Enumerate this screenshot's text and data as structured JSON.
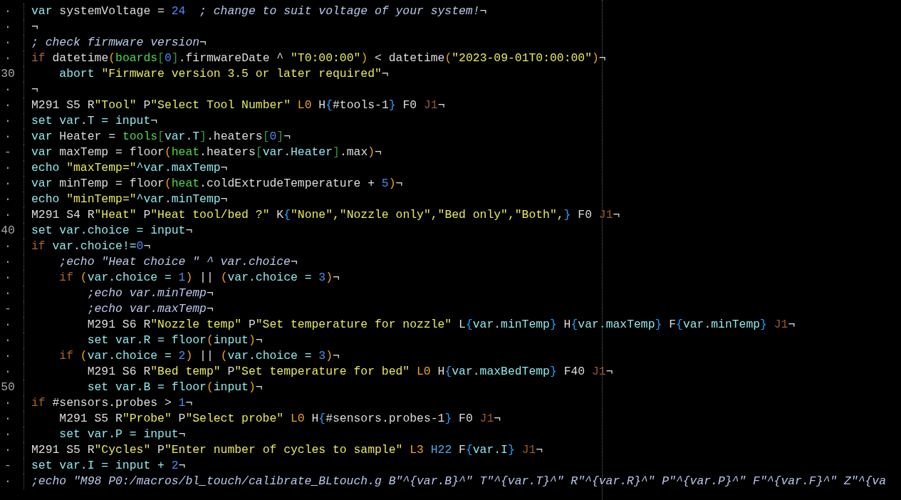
{
  "editor": {
    "lines": [
      {
        "gutter": "·",
        "tokens": [
          {
            "kind": "kw",
            "text": "var"
          },
          {
            "kind": "id",
            "text": " systemVoltage = "
          },
          {
            "kind": "num",
            "text": "24"
          },
          {
            "kind": "com",
            "text": "  ; change to suit voltage of your system!"
          },
          {
            "kind": "eol",
            "text": "¬"
          }
        ]
      },
      {
        "gutter": "·",
        "tokens": [
          {
            "kind": "eol",
            "text": "¬"
          }
        ]
      },
      {
        "gutter": "·",
        "tokens": [
          {
            "kind": "com",
            "text": "; check firmware version"
          },
          {
            "kind": "eol",
            "text": "¬"
          }
        ]
      },
      {
        "gutter": "·",
        "tokens": [
          {
            "kind": "ctl",
            "text": "if"
          },
          {
            "kind": "id",
            "text": " datetime"
          },
          {
            "kind": "paren",
            "text": "("
          },
          {
            "kind": "obj",
            "text": "boards"
          },
          {
            "kind": "brk",
            "text": "["
          },
          {
            "kind": "num",
            "text": "0"
          },
          {
            "kind": "brk",
            "text": "]"
          },
          {
            "kind": "id",
            "text": ".firmwareDate ^ "
          },
          {
            "kind": "str",
            "text": "\"T0:00:00\""
          },
          {
            "kind": "paren",
            "text": ")"
          },
          {
            "kind": "id",
            "text": " < datetime"
          },
          {
            "kind": "paren",
            "text": "("
          },
          {
            "kind": "str",
            "text": "\"2023-09-01T0:00:00\""
          },
          {
            "kind": "paren",
            "text": ")"
          },
          {
            "kind": "eol",
            "text": "¬"
          }
        ]
      },
      {
        "gutter": "30",
        "tokens": [
          {
            "kind": "kw",
            "text": "    abort "
          },
          {
            "kind": "str",
            "text": "\"Firmware version 3.5 or later required\""
          },
          {
            "kind": "eol",
            "text": "¬"
          }
        ]
      },
      {
        "gutter": "·",
        "tokens": [
          {
            "kind": "eol",
            "text": "¬"
          }
        ]
      },
      {
        "gutter": "·",
        "tokens": [
          {
            "kind": "id",
            "text": "M291 S5 R"
          },
          {
            "kind": "str",
            "text": "\"Tool\""
          },
          {
            "kind": "id",
            "text": " P"
          },
          {
            "kind": "str",
            "text": "\"Select Tool Number\""
          },
          {
            "kind": "lp",
            "text": " L0"
          },
          {
            "kind": "id",
            "text": " H"
          },
          {
            "kind": "brace",
            "text": "{"
          },
          {
            "kind": "id",
            "text": "#tools-1"
          },
          {
            "kind": "brace",
            "text": "}"
          },
          {
            "kind": "id",
            "text": " F0 "
          },
          {
            "kind": "jp",
            "text": "J1"
          },
          {
            "kind": "eol",
            "text": "¬"
          }
        ]
      },
      {
        "gutter": "·",
        "tokens": [
          {
            "kind": "kw",
            "text": "set var.T = input"
          },
          {
            "kind": "eol",
            "text": "¬"
          }
        ]
      },
      {
        "gutter": "·",
        "tokens": [
          {
            "kind": "kw",
            "text": "var"
          },
          {
            "kind": "id",
            "text": " Heater = "
          },
          {
            "kind": "obj",
            "text": "tools"
          },
          {
            "kind": "brk",
            "text": "["
          },
          {
            "kind": "kw",
            "text": "var.T"
          },
          {
            "kind": "brk",
            "text": "]"
          },
          {
            "kind": "id",
            "text": ".heaters"
          },
          {
            "kind": "brk",
            "text": "["
          },
          {
            "kind": "num",
            "text": "0"
          },
          {
            "kind": "brk",
            "text": "]"
          },
          {
            "kind": "eol",
            "text": "¬"
          }
        ]
      },
      {
        "gutter": "-",
        "tokens": [
          {
            "kind": "kw",
            "text": "var"
          },
          {
            "kind": "id",
            "text": " maxTemp = floor"
          },
          {
            "kind": "paren",
            "text": "("
          },
          {
            "kind": "obj",
            "text": "heat"
          },
          {
            "kind": "id",
            "text": ".heaters"
          },
          {
            "kind": "brk",
            "text": "["
          },
          {
            "kind": "kw",
            "text": "var.Heater"
          },
          {
            "kind": "brk",
            "text": "]"
          },
          {
            "kind": "id",
            "text": ".max"
          },
          {
            "kind": "paren",
            "text": ")"
          },
          {
            "kind": "eol",
            "text": "¬"
          }
        ]
      },
      {
        "gutter": "·",
        "tokens": [
          {
            "kind": "kw",
            "text": "echo "
          },
          {
            "kind": "str",
            "text": "\"maxTemp=\""
          },
          {
            "kind": "kw",
            "text": "^var.maxTemp"
          },
          {
            "kind": "eol",
            "text": "¬"
          }
        ]
      },
      {
        "gutter": "·",
        "tokens": [
          {
            "kind": "kw",
            "text": "var"
          },
          {
            "kind": "id",
            "text": " minTemp = floor"
          },
          {
            "kind": "paren",
            "text": "("
          },
          {
            "kind": "obj",
            "text": "heat"
          },
          {
            "kind": "id",
            "text": ".coldExtrudeTemperature + "
          },
          {
            "kind": "num",
            "text": "5"
          },
          {
            "kind": "paren",
            "text": ")"
          },
          {
            "kind": "eol",
            "text": "¬"
          }
        ]
      },
      {
        "gutter": "·",
        "tokens": [
          {
            "kind": "kw",
            "text": "echo "
          },
          {
            "kind": "str",
            "text": "\"minTemp=\""
          },
          {
            "kind": "kw",
            "text": "^var.minTemp"
          },
          {
            "kind": "eol",
            "text": "¬"
          }
        ]
      },
      {
        "gutter": "·",
        "tokens": [
          {
            "kind": "id",
            "text": "M291 S4 R"
          },
          {
            "kind": "str",
            "text": "\"Heat\""
          },
          {
            "kind": "id",
            "text": " P"
          },
          {
            "kind": "str",
            "text": "\"Heat tool/bed ?\""
          },
          {
            "kind": "id",
            "text": " K"
          },
          {
            "kind": "brace",
            "text": "{"
          },
          {
            "kind": "str",
            "text": "\"None\",\"Nozzle only\",\"Bed only\",\"Both\","
          },
          {
            "kind": "brace",
            "text": "}"
          },
          {
            "kind": "id",
            "text": " F0 "
          },
          {
            "kind": "jp",
            "text": "J1"
          },
          {
            "kind": "eol",
            "text": "¬"
          }
        ]
      },
      {
        "gutter": "40",
        "tokens": [
          {
            "kind": "kw",
            "text": "set var.choice = input"
          },
          {
            "kind": "eol",
            "text": "¬"
          }
        ]
      },
      {
        "gutter": "·",
        "tokens": [
          {
            "kind": "ctl",
            "text": "if"
          },
          {
            "kind": "kw",
            "text": " var.choice!="
          },
          {
            "kind": "num",
            "text": "0"
          },
          {
            "kind": "eol",
            "text": "¬"
          }
        ]
      },
      {
        "gutter": "·",
        "tokens": [
          {
            "kind": "com",
            "text": "    ;echo \"Heat choice \" ^ var.choice"
          },
          {
            "kind": "eol",
            "text": "¬"
          }
        ]
      },
      {
        "gutter": "·",
        "tokens": [
          {
            "kind": "ctl",
            "text": "    if "
          },
          {
            "kind": "paren",
            "text": "("
          },
          {
            "kind": "kw",
            "text": "var.choice = "
          },
          {
            "kind": "num",
            "text": "1"
          },
          {
            "kind": "paren",
            "text": ")"
          },
          {
            "kind": "id",
            "text": " || "
          },
          {
            "kind": "paren",
            "text": "("
          },
          {
            "kind": "kw",
            "text": "var.choice = "
          },
          {
            "kind": "num",
            "text": "3"
          },
          {
            "kind": "paren",
            "text": ")"
          },
          {
            "kind": "eol",
            "text": "¬"
          }
        ]
      },
      {
        "gutter": "·",
        "tokens": [
          {
            "kind": "com",
            "text": "        ;echo var.minTemp"
          },
          {
            "kind": "eol",
            "text": "¬"
          }
        ]
      },
      {
        "gutter": "-",
        "tokens": [
          {
            "kind": "com",
            "text": "        ;echo var.maxTemp"
          },
          {
            "kind": "eol",
            "text": "¬"
          }
        ]
      },
      {
        "gutter": "·",
        "tokens": [
          {
            "kind": "id",
            "text": "        M291 S6 R"
          },
          {
            "kind": "str",
            "text": "\"Nozzle temp\""
          },
          {
            "kind": "id",
            "text": " P"
          },
          {
            "kind": "str",
            "text": "\"Set temperature for nozzle\""
          },
          {
            "kind": "id",
            "text": " L"
          },
          {
            "kind": "brace",
            "text": "{"
          },
          {
            "kind": "kw",
            "text": "var.minTemp"
          },
          {
            "kind": "brace",
            "text": "}"
          },
          {
            "kind": "id",
            "text": " H"
          },
          {
            "kind": "brace",
            "text": "{"
          },
          {
            "kind": "kw",
            "text": "var.maxTemp"
          },
          {
            "kind": "brace",
            "text": "}"
          },
          {
            "kind": "id",
            "text": " F"
          },
          {
            "kind": "brace",
            "text": "{"
          },
          {
            "kind": "kw",
            "text": "var.minTemp"
          },
          {
            "kind": "brace",
            "text": "}"
          },
          {
            "kind": "jp",
            "text": " J1"
          },
          {
            "kind": "eol",
            "text": "¬"
          }
        ]
      },
      {
        "gutter": "·",
        "tokens": [
          {
            "kind": "kw",
            "text": "        set var.R = floor"
          },
          {
            "kind": "paren",
            "text": "("
          },
          {
            "kind": "kw",
            "text": "input"
          },
          {
            "kind": "paren",
            "text": ")"
          },
          {
            "kind": "eol",
            "text": "¬"
          }
        ]
      },
      {
        "gutter": "·",
        "tokens": [
          {
            "kind": "ctl",
            "text": "    if "
          },
          {
            "kind": "paren",
            "text": "("
          },
          {
            "kind": "kw",
            "text": "var.choice = "
          },
          {
            "kind": "num",
            "text": "2"
          },
          {
            "kind": "paren",
            "text": ")"
          },
          {
            "kind": "id",
            "text": " || "
          },
          {
            "kind": "paren",
            "text": "("
          },
          {
            "kind": "kw",
            "text": "var.choice = "
          },
          {
            "kind": "num",
            "text": "3"
          },
          {
            "kind": "paren",
            "text": ")"
          },
          {
            "kind": "eol",
            "text": "¬"
          }
        ]
      },
      {
        "gutter": "·",
        "tokens": [
          {
            "kind": "id",
            "text": "        M291 S6 R"
          },
          {
            "kind": "str",
            "text": "\"Bed temp\""
          },
          {
            "kind": "id",
            "text": " P"
          },
          {
            "kind": "str",
            "text": "\"Set temperature for bed\""
          },
          {
            "kind": "lp",
            "text": " L0"
          },
          {
            "kind": "id",
            "text": " H"
          },
          {
            "kind": "brace",
            "text": "{"
          },
          {
            "kind": "kw",
            "text": "var.maxBedTemp"
          },
          {
            "kind": "brace",
            "text": "}"
          },
          {
            "kind": "id",
            "text": " F40 "
          },
          {
            "kind": "jp",
            "text": "J1"
          },
          {
            "kind": "eol",
            "text": "¬"
          }
        ]
      },
      {
        "gutter": "50",
        "tokens": [
          {
            "kind": "kw",
            "text": "        set var.B = floor"
          },
          {
            "kind": "paren",
            "text": "("
          },
          {
            "kind": "kw",
            "text": "input"
          },
          {
            "kind": "paren",
            "text": ")"
          },
          {
            "kind": "eol",
            "text": "¬"
          }
        ]
      },
      {
        "gutter": "·",
        "tokens": [
          {
            "kind": "ctl",
            "text": "if"
          },
          {
            "kind": "id",
            "text": " #sensors.probes > "
          },
          {
            "kind": "num",
            "text": "1"
          },
          {
            "kind": "eol",
            "text": "¬"
          }
        ]
      },
      {
        "gutter": "·",
        "tokens": [
          {
            "kind": "id",
            "text": "    M291 S5 R"
          },
          {
            "kind": "str",
            "text": "\"Probe\""
          },
          {
            "kind": "id",
            "text": " P"
          },
          {
            "kind": "str",
            "text": "\"Select probe\""
          },
          {
            "kind": "lp",
            "text": " L0"
          },
          {
            "kind": "id",
            "text": " H"
          },
          {
            "kind": "brace",
            "text": "{"
          },
          {
            "kind": "id",
            "text": "#sensors.probes-1"
          },
          {
            "kind": "brace",
            "text": "}"
          },
          {
            "kind": "id",
            "text": " F0 "
          },
          {
            "kind": "jp",
            "text": "J1"
          },
          {
            "kind": "eol",
            "text": "¬"
          }
        ]
      },
      {
        "gutter": "·",
        "tokens": [
          {
            "kind": "kw",
            "text": "    set var.P = input"
          },
          {
            "kind": "eol",
            "text": "¬"
          }
        ]
      },
      {
        "gutter": "·",
        "tokens": [
          {
            "kind": "id",
            "text": "M291 S5 R"
          },
          {
            "kind": "str",
            "text": "\"Cycles\""
          },
          {
            "kind": "id",
            "text": " P"
          },
          {
            "kind": "str",
            "text": "\"Enter number of cycles to sample\""
          },
          {
            "kind": "lp",
            "text": " L3"
          },
          {
            "kind": "hp",
            "text": " H22"
          },
          {
            "kind": "id",
            "text": " F"
          },
          {
            "kind": "brace",
            "text": "{"
          },
          {
            "kind": "kw",
            "text": "var.I"
          },
          {
            "kind": "brace",
            "text": "}"
          },
          {
            "kind": "jp",
            "text": " J1"
          },
          {
            "kind": "eol",
            "text": "¬"
          }
        ]
      },
      {
        "gutter": "-",
        "tokens": [
          {
            "kind": "kw",
            "text": "set var.I = input + "
          },
          {
            "kind": "num",
            "text": "2"
          },
          {
            "kind": "eol",
            "text": "¬"
          }
        ]
      },
      {
        "gutter": "·",
        "tokens": [
          {
            "kind": "com",
            "text": ";echo \"M98 P0:/macros/bl_touch/calibrate_BLtouch.g B\"^{var.B}^\" T\"^{var.T}^\" R\"^{var.R}^\" P\"^{var.P}^\" F\"^{var.F}^\" Z\"^{va"
          }
        ]
      }
    ]
  }
}
